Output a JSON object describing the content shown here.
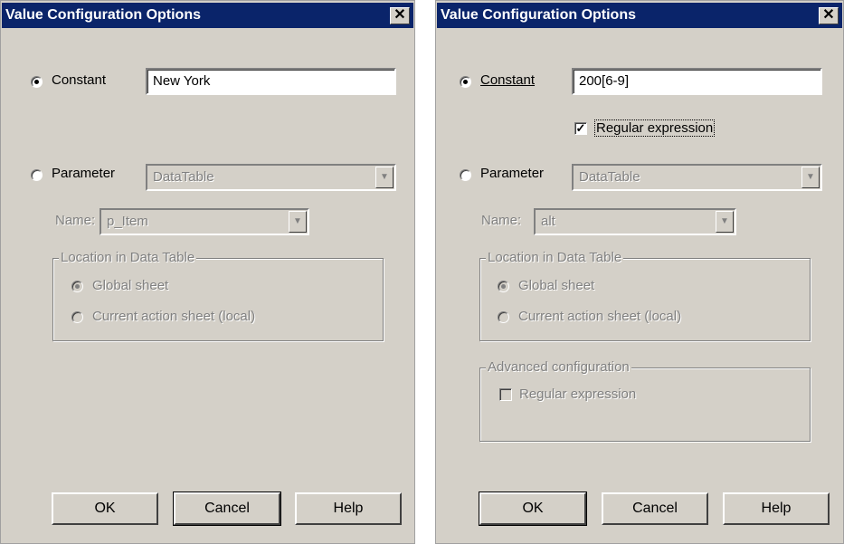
{
  "left": {
    "title": "Value Configuration Options",
    "constant_label": "Constant",
    "constant_value": "New York",
    "parameter_label": "Parameter",
    "parameter_value": "DataTable",
    "name_label": "Name:",
    "name_value": "p_Item",
    "location_legend": "Location in Data Table",
    "global_sheet": "Global sheet",
    "current_sheet": "Current action sheet (local)",
    "ok": "OK",
    "cancel": "Cancel",
    "help": "Help"
  },
  "right": {
    "title": "Value Configuration Options",
    "constant_label": "Constant",
    "constant_value": "200[6-9]",
    "regex_label": "Regular expression",
    "parameter_label": "Parameter",
    "parameter_value": "DataTable",
    "name_label": "Name:",
    "name_value": "alt",
    "location_legend": "Location in Data Table",
    "global_sheet": "Global sheet",
    "current_sheet": "Current action sheet (local)",
    "advanced_legend": "Advanced configuration",
    "advanced_regex_label": "Regular expression",
    "ok": "OK",
    "cancel": "Cancel",
    "help": "Help"
  }
}
